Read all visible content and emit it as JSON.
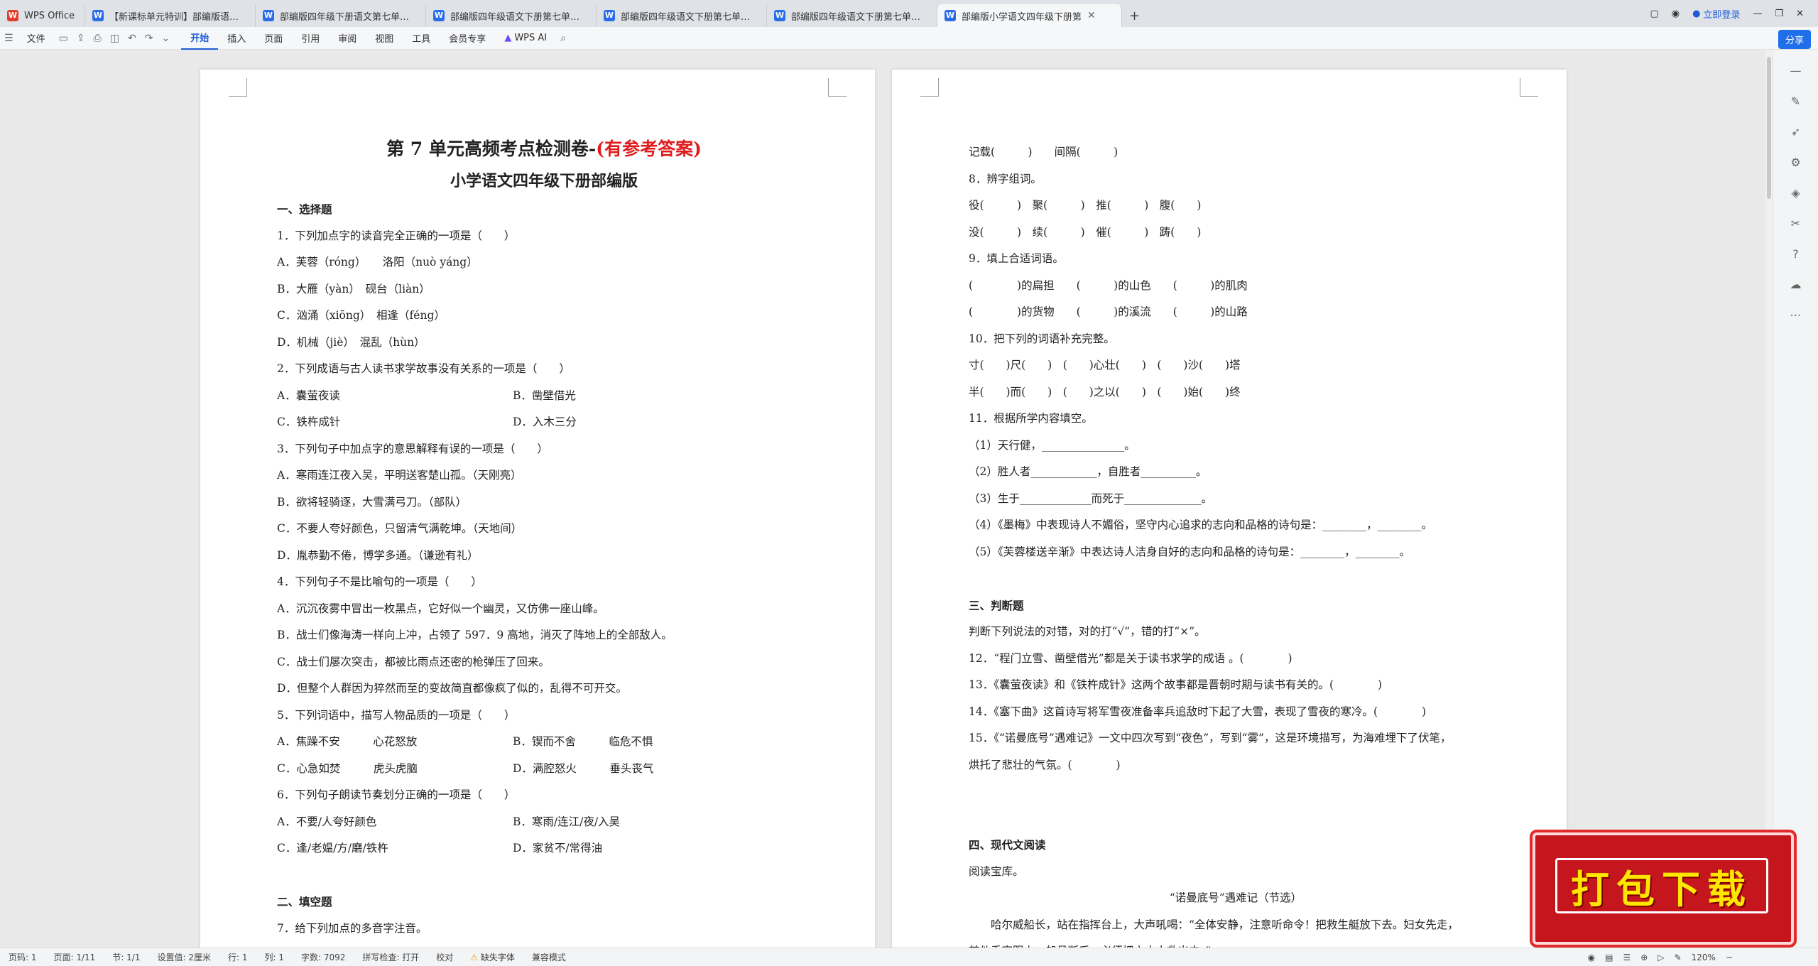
{
  "tabs": [
    {
      "label": "WPS Office",
      "icon": "wps-logo-icon"
    },
    {
      "label": "【新课标单元特训】部编版语文四年",
      "icon": "word-doc-icon"
    },
    {
      "label": "部编版四年级下册语文第七单元测试",
      "icon": "word-doc-icon"
    },
    {
      "label": "部编版四年级语文下册第七单元试卷",
      "icon": "word-doc-icon"
    },
    {
      "label": "部编版四年级语文下册第七单元综合",
      "icon": "word-doc-icon"
    },
    {
      "label": "部编版四年级语文下册第七单元综合",
      "icon": "word-doc-icon"
    },
    {
      "label": "部编版小学语文四年级下册第",
      "icon": "word-doc-icon",
      "active": true
    }
  ],
  "top_right": {
    "login": "立即登录"
  },
  "toolbar": {
    "file": "文件",
    "menus": [
      "开始",
      "插入",
      "页面",
      "引用",
      "审阅",
      "视图",
      "工具",
      "会员专享"
    ],
    "ai": "WPS AI",
    "share": "分享"
  },
  "page1": {
    "title_black": "第 7 单元高频考点检测卷-",
    "title_red": "(有参考答案)",
    "subtitle": "小学语文四年级下册部编版",
    "lines": [
      {
        "text": "一、选择题",
        "bold": true
      },
      {
        "text": "1．下列加点字的读音完全正确的一项是（　　）"
      },
      {
        "text": "A．芙蓉（róng）　　洛阳（nuò yáng）"
      },
      {
        "text": "B．大雁（yàn）　砚台（liàn）"
      },
      {
        "text": "C．汹涌（xiōng）　相逢（féng）"
      },
      {
        "text": "D．机械（jiè）　混乱（hùn）"
      },
      {
        "text": "2．下列成语与古人读书求学故事没有关系的一项是（　　）"
      },
      {
        "left": "A．囊萤夜读",
        "right": "B．凿壁借光"
      },
      {
        "left": "C．铁杵成针",
        "right": "D．入木三分"
      },
      {
        "text": "3．下列句子中加点字的意思解释有误的一项是（　　）"
      },
      {
        "text": "A．寒雨连江夜入吴，平明送客楚山孤。（天刚亮）"
      },
      {
        "text": "B．欲将轻骑逐，大雪满弓刀。（部队）"
      },
      {
        "text": "C．不要人夸好颜色，只留清气满乾坤。（天地间）"
      },
      {
        "text": "D．胤恭勤不倦，博学多通。（谦逊有礼）"
      },
      {
        "text": "4．下列句子不是比喻句的一项是（　　）"
      },
      {
        "text": "A．沉沉夜雾中冒出一枚黑点，它好似一个幽灵，又仿佛一座山峰。"
      },
      {
        "text": "B．战士们像海涛一样向上冲，占领了 597．9 高地，消灭了阵地上的全部敌人。"
      },
      {
        "text": "C．战士们屡次突击，都被比雨点还密的枪弹压了回来。"
      },
      {
        "text": "D．但整个人群因为猝然而至的变故简直都像疯了似的，乱得不可开交。"
      },
      {
        "text": "5．下列词语中，描写人物品质的一项是（　　）"
      },
      {
        "left": "A．焦躁不安　　　心花怒放",
        "right": "B．锲而不舍　　　临危不惧"
      },
      {
        "left": "C．心急如焚　　　虎头虎脑",
        "right": "D．满腔怒火　　　垂头丧气"
      },
      {
        "text": "6．下列句子朗读节奏划分正确的一项是（　　）"
      },
      {
        "left": "A．不要/人夸好颜色",
        "right": "B．寒雨/连江/夜/入吴"
      },
      {
        "left": "C．逢/老媪/方/磨/铁杵",
        "right": "D．家贫不/常得油"
      },
      {
        "gap": true
      },
      {
        "text": "二、填空题",
        "bold": true
      },
      {
        "text": "7．给下列加点的多音字注音。"
      }
    ]
  },
  "page2": {
    "lines": [
      {
        "text": "记载(　　　)　　间隔(　　　)"
      },
      {
        "text": "8．辨字组词。"
      },
      {
        "text": "役(　　　)　聚(　　　)　推(　　　)　腹(　　)"
      },
      {
        "text": "没(　　　)　续(　　　)　催(　　　)　踌(　　)"
      },
      {
        "text": "9．填上合适词语。"
      },
      {
        "text": "(　　　　)的扁担　　(　　　)的山色　　(　　　)的肌肉"
      },
      {
        "text": "(　　　　)的货物　　(　　　)的溪流　　(　　　)的山路"
      },
      {
        "text": "10．把下列的词语补充完整。"
      },
      {
        "text": "寸(　　)尺(　　)　(　　)心壮(　　)　(　　)沙(　　)塔"
      },
      {
        "text": "半(　　)而(　　)　(　　)之以(　　)　(　　)始(　　)终"
      },
      {
        "text": "11．根据所学内容填空。"
      },
      {
        "text": "（1）天行健，_______________。"
      },
      {
        "text": "（2）胜人者____________，自胜者__________。"
      },
      {
        "text": "（3）生于_____________而死于______________。"
      },
      {
        "text": "（4）《墨梅》中表现诗人不媚俗，坚守内心追求的志向和品格的诗句是：________，________。"
      },
      {
        "text": "（5）《芙蓉楼送辛渐》中表达诗人洁身自好的志向和品格的诗句是：________，________。"
      },
      {
        "gap": true
      },
      {
        "text": "三、判断题",
        "bold": true
      },
      {
        "text": "判断下列说法的对错，对的打“√”，错的打“×”。"
      },
      {
        "text": "12．“程门立雪、凿壁借光”都是关于读书求学的成语 。(　　　　)"
      },
      {
        "text": "13．《囊萤夜读》和《铁杵成针》这两个故事都是晋朝时期与读书有关的。(　　　　)"
      },
      {
        "text": "14．《塞下曲》这首诗写将军雪夜准备率兵追敌时下起了大雪，表现了雪夜的寒冷。(　　　　)"
      },
      {
        "text": "15．《“诺曼底号”遇难记》一文中四次写到“夜色”，写到“雾”，这是环境描写，为海难埋下了伏笔，"
      },
      {
        "text": "烘托了悲壮的气氛。(　　　　)"
      },
      {
        "gap": true
      },
      {
        "gap": true
      },
      {
        "text": "四、现代文阅读",
        "bold": true
      },
      {
        "text": "阅读宝库。"
      },
      {
        "text": "“诺曼底号”遇难记（节选）",
        "center": true
      },
      {
        "text": "　　哈尔威船长，站在指挥台上，大声吼喝：“全体安静，注意听命令！把救生艇放下去。妇女先走，"
      },
      {
        "text": "其他乘客跟上，船员断后。必须把六十人救出去。”"
      }
    ]
  },
  "status": {
    "page": "页码: 1",
    "pages": "页面: 1/11",
    "section": "节: 1/1",
    "setting": "设置值: 2厘米",
    "row": "行: 1",
    "col": "列: 1",
    "words": "字数: 7092",
    "spell": "拼写检查: 打开",
    "proof": "校对",
    "missing_font": "缺失字体",
    "compat": "兼容模式",
    "zoom": "120%"
  },
  "banner": {
    "text": "打包下载"
  }
}
